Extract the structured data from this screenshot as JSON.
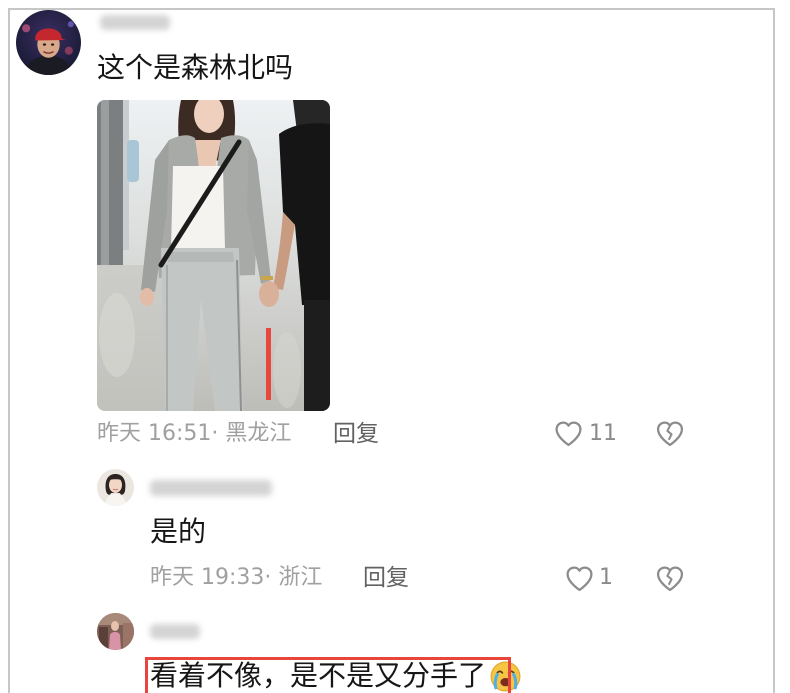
{
  "comment": {
    "text": "这个是森林北吗",
    "meta": "昨天 16:51· 黑龙江",
    "reply_label": "回复",
    "likes": "11"
  },
  "replies": [
    {
      "text": "是的",
      "meta": "昨天 19:33· 浙江",
      "reply_label": "回复",
      "likes": "1"
    },
    {
      "text": "看着不像，是不是又分手了",
      "emoji": "crying-face-emoji"
    }
  ],
  "icons": {
    "like": "heart-outline-icon",
    "dislike": "broken-heart-icon",
    "emoji": "crying-face-emoji-icon"
  },
  "colors": {
    "highlight_box": "#e8463c",
    "meta_text": "#a0a0a0",
    "body_text": "#161616",
    "frame_border": "#c6c6c6"
  }
}
